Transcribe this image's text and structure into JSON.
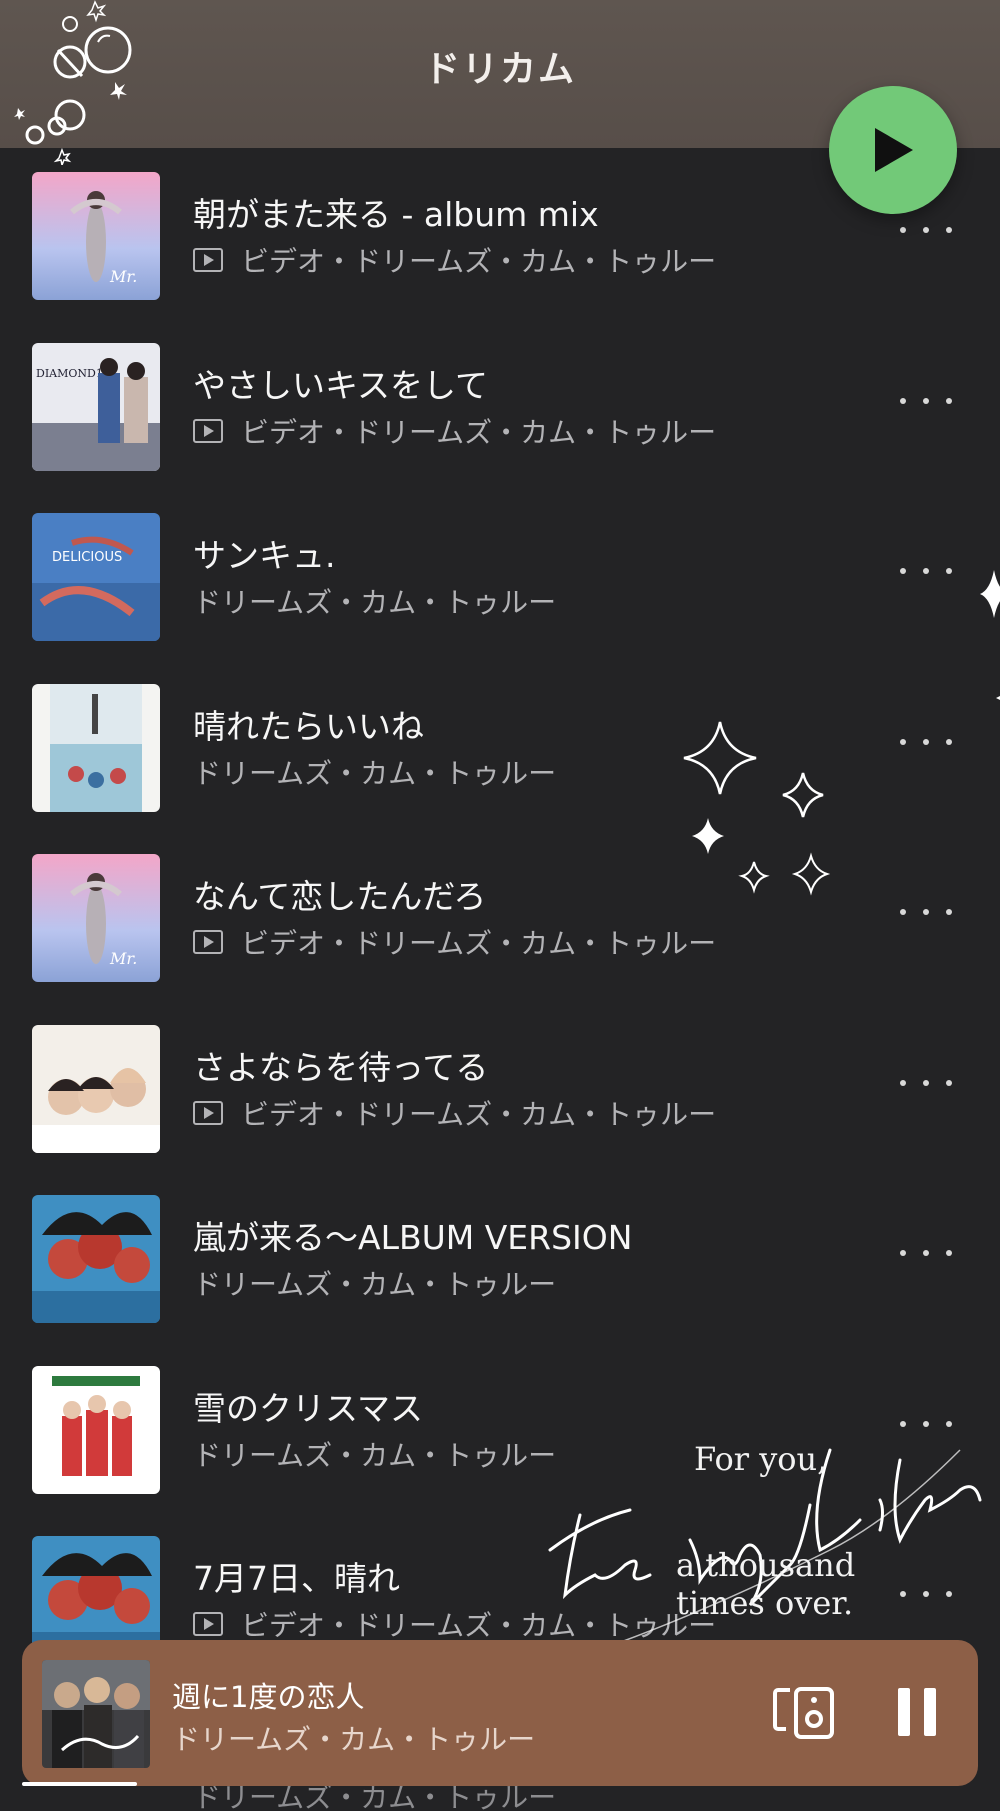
{
  "header": {
    "title": "ドリカム"
  },
  "songs": [
    {
      "title": "朝がまた来る - album mix",
      "subtitle": "ビデオ・ドリームズ・カム・トゥルー",
      "is_video": true,
      "art": "pink-sky"
    },
    {
      "title": "やさしいキスをして",
      "subtitle": "ビデオ・ドリームズ・カム・トゥルー",
      "is_video": true,
      "art": "diamond"
    },
    {
      "title": "サンキュ.",
      "subtitle": "ドリームズ・カム・トゥルー",
      "is_video": false,
      "art": "underwater"
    },
    {
      "title": "晴れたらいいね",
      "subtitle": "ドリームズ・カム・トゥルー",
      "is_video": false,
      "art": "single"
    },
    {
      "title": "なんて恋したんだろ",
      "subtitle": "ビデオ・ドリームズ・カム・トゥルー",
      "is_video": true,
      "art": "pink-sky"
    },
    {
      "title": "さよならを待ってる",
      "subtitle": "ビデオ・ドリームズ・カム・トゥルー",
      "is_video": true,
      "art": "white-trio"
    },
    {
      "title": "嵐が来る〜ALBUM VERSION",
      "subtitle": "ドリームズ・カム・トゥルー",
      "is_video": false,
      "art": "red-trio"
    },
    {
      "title": "雪のクリスマス",
      "subtitle": "ドリームズ・カム・トゥルー",
      "is_video": false,
      "art": "xmas"
    },
    {
      "title": "7月7日、晴れ",
      "subtitle": "ビデオ・ドリームズ・カム・トゥルー",
      "is_video": true,
      "art": "red-trio"
    }
  ],
  "peek_row": {
    "subtitle": "ドリームズ・カム・トゥルー"
  },
  "overlay_text": {
    "line1": "For you,",
    "line2": "a thousand",
    "line3": "times over."
  },
  "mini_player": {
    "title": "週に1度の恋人",
    "artist": "ドリームズ・カム・トゥルー",
    "progress": 0.12
  },
  "icons": {
    "play": "play-icon",
    "more": "more-vert-icon",
    "video": "video-icon",
    "cast": "speaker-cast-icon",
    "pause": "pause-icon"
  },
  "colors": {
    "background": "#232325",
    "header": "#5a514c",
    "play_fab": "#72c978",
    "mini_player": "#8d5f47"
  }
}
